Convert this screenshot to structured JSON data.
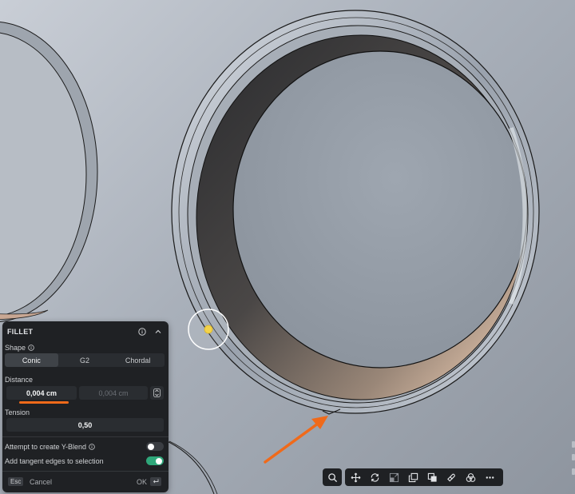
{
  "fillet_panel": {
    "title": "FILLET",
    "shape_label": "Shape",
    "shape_options": [
      "Conic",
      "G2",
      "Chordal"
    ],
    "shape_selected": "Conic",
    "distance_label": "Distance",
    "distance_value": "0,004 cm",
    "distance_value_2": "0,004 cm",
    "tension_label": "Tension",
    "tension_value": "0,50",
    "y_blend_label": "Attempt to create Y-Blend",
    "y_blend_on": false,
    "tangent_label": "Add tangent edges to selection",
    "tangent_on": true,
    "esc_key": "Esc",
    "cancel_label": "Cancel",
    "ok_label": "OK"
  },
  "toolbar": {
    "tools": [
      "search-icon",
      "move-icon",
      "rotate-icon",
      "scale-icon",
      "copy-icon",
      "boolean-icon",
      "eraser-icon",
      "combine-icon",
      "more-icon"
    ]
  },
  "colors": {
    "accent_orange": "#f06a1a",
    "toggle_on": "#2fa77a",
    "panel_bg": "#1f2124"
  }
}
